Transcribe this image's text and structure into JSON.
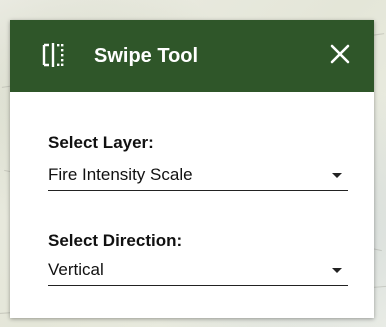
{
  "header": {
    "title": "Swipe Tool",
    "icon": "swipe-icon",
    "close_icon": "close-icon"
  },
  "layer_field": {
    "label": "Select Layer:",
    "value": "Fire Intensity Scale"
  },
  "direction_field": {
    "label": "Select Direction:",
    "value": "Vertical"
  },
  "colors": {
    "header_bg": "#2f5629",
    "header_text": "#ffffff",
    "panel_bg": "#ffffff",
    "text": "#111111"
  }
}
